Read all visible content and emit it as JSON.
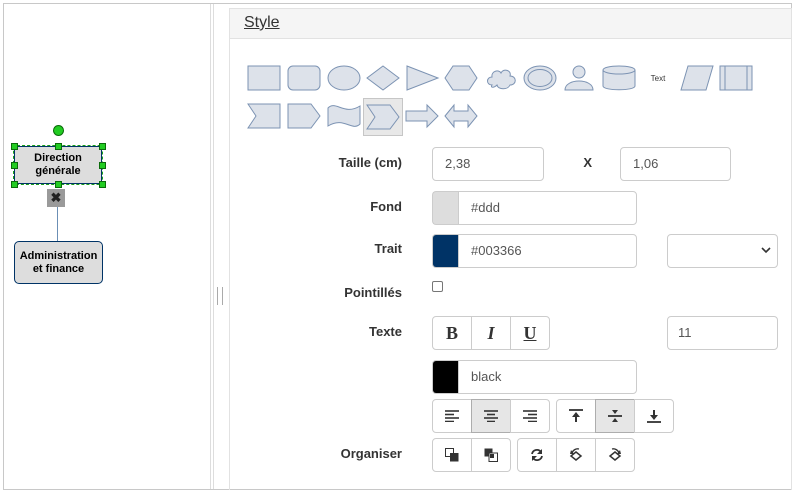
{
  "canvas": {
    "node1_label": "Direction générale",
    "node2_label": "Administration et finance",
    "delete_glyph": "✖"
  },
  "panel": {
    "title": "Style",
    "shapes": [
      "rectangle-icon",
      "rounded-rectangle-icon",
      "ellipse-icon",
      "diamond-icon",
      "triangle-icon",
      "hexagon-icon",
      "cloud-icon",
      "double-ellipse-icon",
      "actor-icon",
      "cylinder-icon",
      "text-shape-icon",
      "parallelogram-icon",
      "process-icon",
      "notched-arrow-icon",
      "pentagon-icon",
      "tape-icon",
      "chevron-icon",
      "arrow-icon",
      "double-arrow-icon"
    ],
    "text_shape_label": "Text",
    "selected_shape": "chevron-icon"
  },
  "form": {
    "size_label": "Taille (cm)",
    "width_value": "2,38",
    "x_label": "X",
    "height_value": "1,06",
    "fill_label": "Fond",
    "fill_value": "#ddd",
    "fill_color": "#dddddd",
    "stroke_label": "Trait",
    "stroke_value": "#003366",
    "stroke_color": "#003366",
    "stroke_width_value": "",
    "dashed_label": "Pointillés",
    "dashed_checked": false,
    "text_label": "Texte",
    "bold_label": "B",
    "italic_label": "I",
    "underline_label": "U",
    "font_size_value": "11",
    "text_color_value": "black",
    "text_color": "#000000",
    "align_horizontal": "center",
    "align_vertical": "middle",
    "arrange_label": "Organiser"
  }
}
